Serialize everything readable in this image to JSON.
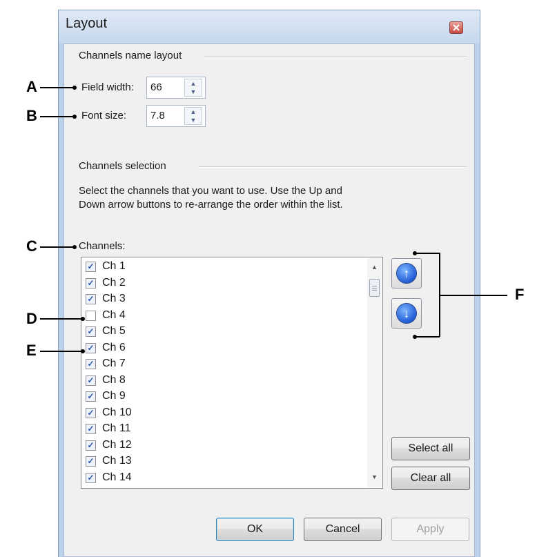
{
  "window": {
    "title": "Layout",
    "close_icon": "close-icon"
  },
  "name_layout": {
    "group_label": "Channels name layout",
    "field_width_label": "Field width:",
    "field_width_value": "66",
    "font_size_label": "Font size:",
    "font_size_value": "7.8"
  },
  "selection": {
    "group_label": "Channels selection",
    "instructions_line1": "Select the channels that you want to use. Use the Up and",
    "instructions_line2": "Down arrow buttons to re-arrange the order within the list.",
    "channels_label": "Channels:",
    "items": [
      {
        "label": "Ch 1",
        "checked": true
      },
      {
        "label": "Ch 2",
        "checked": true
      },
      {
        "label": "Ch 3",
        "checked": true
      },
      {
        "label": "Ch 4",
        "checked": false
      },
      {
        "label": "Ch 5",
        "checked": true
      },
      {
        "label": "Ch 6",
        "checked": true
      },
      {
        "label": "Ch 7",
        "checked": true
      },
      {
        "label": "Ch 8",
        "checked": true
      },
      {
        "label": "Ch 9",
        "checked": true
      },
      {
        "label": "Ch 10",
        "checked": true
      },
      {
        "label": "Ch 11",
        "checked": true
      },
      {
        "label": "Ch 12",
        "checked": true
      },
      {
        "label": "Ch 13",
        "checked": true
      },
      {
        "label": "Ch 14",
        "checked": true
      }
    ],
    "move_up_icon": "arrow-up-icon",
    "move_down_icon": "arrow-down-icon",
    "select_all_label": "Select all",
    "clear_all_label": "Clear all"
  },
  "footer": {
    "ok_label": "OK",
    "cancel_label": "Cancel",
    "apply_label": "Apply"
  },
  "callouts": {
    "a": "A",
    "b": "B",
    "c": "C",
    "d": "D",
    "e": "E",
    "f": "F"
  },
  "colors": {
    "title_bar": "#c6d8ee",
    "check": "#2a55a8",
    "arrow_button": "#1f5bd6"
  }
}
